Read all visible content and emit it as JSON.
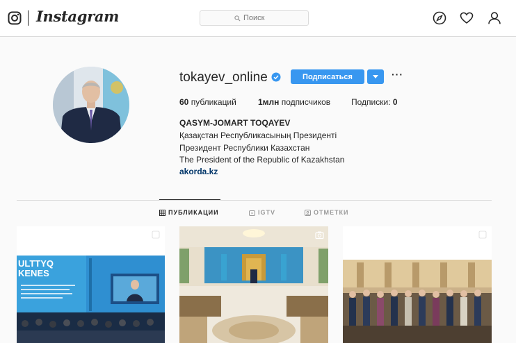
{
  "nav": {
    "logo_text": "Instagram",
    "search_placeholder": "Поиск",
    "icons": [
      "instagram-glyph",
      "search-icon",
      "compass-icon",
      "heart-icon",
      "user-icon"
    ]
  },
  "profile": {
    "username": "tokayev_online",
    "verified": true,
    "follow_label": "Подписаться",
    "stats": {
      "posts_value": "60",
      "posts_label": "публикаций",
      "followers_value": "1млн",
      "followers_label": "подписчиков",
      "following_label": "Подписки:",
      "following_value": "0"
    },
    "bio": {
      "name": "QASYM-JOMART TOQAYEV",
      "lines": [
        "Қазақстан Республикасының Президенті",
        "Президент Республики Казахстан",
        "The President of the Republic of Kazakhstan"
      ],
      "link": "akorda.kz"
    }
  },
  "tabs": [
    {
      "label": "ПУБЛИКАЦИИ",
      "icon": "grid-icon",
      "active": true
    },
    {
      "label": "IGTV",
      "icon": "igtv-icon",
      "active": false
    },
    {
      "label": "ОТМЕТКИ",
      "icon": "tagged-icon",
      "active": false
    }
  ],
  "posts": [
    {
      "badge": "carousel-icon",
      "banner_text_1": "ULTTYQ",
      "banner_text_2": "KENES"
    },
    {
      "badge": "camera-icon"
    },
    {
      "badge": "carousel-icon"
    }
  ],
  "colors": {
    "accent": "#3897f0",
    "link": "#003569",
    "border": "#dbdbdb",
    "background": "#fafafa"
  }
}
